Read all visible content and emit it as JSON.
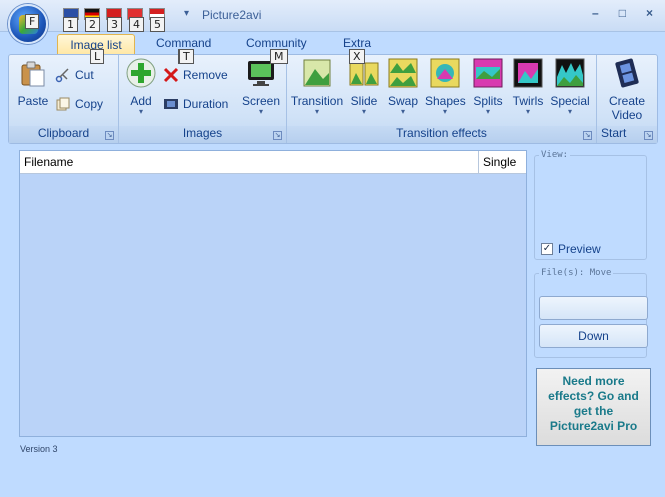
{
  "window": {
    "title": "Picture2avi",
    "minimize": "–",
    "maximize": "□",
    "close": "×"
  },
  "keytips": {
    "file": "F",
    "qat": [
      "1",
      "2",
      "3",
      "4",
      "5"
    ],
    "image_list": "L",
    "command": "T",
    "community": "M",
    "extra": "X"
  },
  "tabs": [
    "Image list",
    "Command",
    "Community",
    "Extra"
  ],
  "ribbon": {
    "clipboard": {
      "label": "Clipboard",
      "paste": "Paste",
      "cut": "Cut",
      "copy": "Copy"
    },
    "images": {
      "label": "Images",
      "add": "Add",
      "remove": "Remove",
      "duration": "Duration",
      "screen": "Screen"
    },
    "transition_effects": {
      "label": "Transition effects",
      "items": [
        "Transition",
        "Slide",
        "Swap",
        "Shapes",
        "Splits",
        "Twirls",
        "Special"
      ]
    },
    "start": {
      "label": "Start",
      "create_video_line1": "Create",
      "create_video_line2": "Video"
    }
  },
  "list": {
    "columns": [
      "Filename",
      "Single"
    ]
  },
  "view_panel": {
    "legend": "View:",
    "preview_label": "Preview",
    "preview_checked": true
  },
  "files_panel": {
    "legend": "File(s): Move",
    "up_label": "",
    "down_label": "Down"
  },
  "promo": {
    "line1": "Need more",
    "line2": "effects?  Go and",
    "line3": "get the",
    "line4": "Picture2avi Pro"
  },
  "footer": {
    "version": "Version 3"
  },
  "colors": {
    "background": "#bfdbff",
    "accent": "#15428b",
    "promo_text": "#1a7a8a"
  }
}
